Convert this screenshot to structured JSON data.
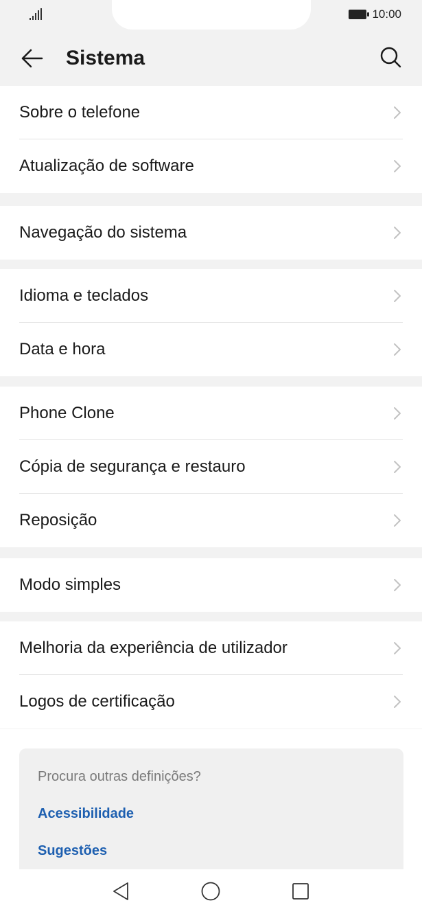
{
  "status_bar": {
    "time": "10:00",
    "signal_icon": "signal-bars-icon",
    "battery_icon": "battery-icon"
  },
  "header": {
    "title": "Sistema",
    "back_icon": "arrow-left-icon",
    "search_icon": "search-icon"
  },
  "groups": [
    {
      "items": [
        {
          "label": "Sobre o telefone"
        },
        {
          "label": "Atualização de software"
        }
      ]
    },
    {
      "items": [
        {
          "label": "Navegação do sistema"
        }
      ]
    },
    {
      "items": [
        {
          "label": "Idioma e teclados"
        },
        {
          "label": "Data e hora"
        }
      ]
    },
    {
      "items": [
        {
          "label": "Phone Clone"
        },
        {
          "label": "Cópia de segurança e restauro"
        },
        {
          "label": "Reposição"
        }
      ]
    },
    {
      "items": [
        {
          "label": "Modo simples"
        }
      ]
    },
    {
      "items": [
        {
          "label": "Melhoria da experiência de utilizador"
        },
        {
          "label": "Logos de certificação"
        }
      ]
    }
  ],
  "suggestions": {
    "question": "Procura outras definições?",
    "links": [
      "Acessibilidade",
      "Sugestões"
    ]
  },
  "nav_bar": {
    "back_icon": "triangle-back-icon",
    "home_icon": "circle-home-icon",
    "recents_icon": "square-recents-icon"
  },
  "colors": {
    "background": "#f2f2f2",
    "card": "#ffffff",
    "link": "#1d5fb0",
    "divider": "#e3e3e3"
  }
}
